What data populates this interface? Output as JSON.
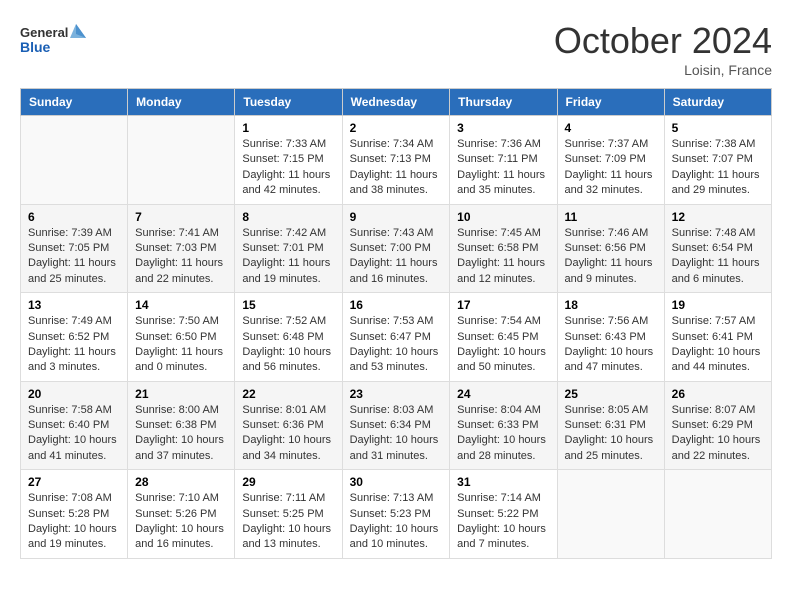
{
  "header": {
    "logo_general": "General",
    "logo_blue": "Blue",
    "month_title": "October 2024",
    "location": "Loisin, France"
  },
  "days_of_week": [
    "Sunday",
    "Monday",
    "Tuesday",
    "Wednesday",
    "Thursday",
    "Friday",
    "Saturday"
  ],
  "weeks": [
    [
      {
        "day": "",
        "sunrise": "",
        "sunset": "",
        "daylight": ""
      },
      {
        "day": "",
        "sunrise": "",
        "sunset": "",
        "daylight": ""
      },
      {
        "day": "1",
        "sunrise": "Sunrise: 7:33 AM",
        "sunset": "Sunset: 7:15 PM",
        "daylight": "Daylight: 11 hours and 42 minutes."
      },
      {
        "day": "2",
        "sunrise": "Sunrise: 7:34 AM",
        "sunset": "Sunset: 7:13 PM",
        "daylight": "Daylight: 11 hours and 38 minutes."
      },
      {
        "day": "3",
        "sunrise": "Sunrise: 7:36 AM",
        "sunset": "Sunset: 7:11 PM",
        "daylight": "Daylight: 11 hours and 35 minutes."
      },
      {
        "day": "4",
        "sunrise": "Sunrise: 7:37 AM",
        "sunset": "Sunset: 7:09 PM",
        "daylight": "Daylight: 11 hours and 32 minutes."
      },
      {
        "day": "5",
        "sunrise": "Sunrise: 7:38 AM",
        "sunset": "Sunset: 7:07 PM",
        "daylight": "Daylight: 11 hours and 29 minutes."
      }
    ],
    [
      {
        "day": "6",
        "sunrise": "Sunrise: 7:39 AM",
        "sunset": "Sunset: 7:05 PM",
        "daylight": "Daylight: 11 hours and 25 minutes."
      },
      {
        "day": "7",
        "sunrise": "Sunrise: 7:41 AM",
        "sunset": "Sunset: 7:03 PM",
        "daylight": "Daylight: 11 hours and 22 minutes."
      },
      {
        "day": "8",
        "sunrise": "Sunrise: 7:42 AM",
        "sunset": "Sunset: 7:01 PM",
        "daylight": "Daylight: 11 hours and 19 minutes."
      },
      {
        "day": "9",
        "sunrise": "Sunrise: 7:43 AM",
        "sunset": "Sunset: 7:00 PM",
        "daylight": "Daylight: 11 hours and 16 minutes."
      },
      {
        "day": "10",
        "sunrise": "Sunrise: 7:45 AM",
        "sunset": "Sunset: 6:58 PM",
        "daylight": "Daylight: 11 hours and 12 minutes."
      },
      {
        "day": "11",
        "sunrise": "Sunrise: 7:46 AM",
        "sunset": "Sunset: 6:56 PM",
        "daylight": "Daylight: 11 hours and 9 minutes."
      },
      {
        "day": "12",
        "sunrise": "Sunrise: 7:48 AM",
        "sunset": "Sunset: 6:54 PM",
        "daylight": "Daylight: 11 hours and 6 minutes."
      }
    ],
    [
      {
        "day": "13",
        "sunrise": "Sunrise: 7:49 AM",
        "sunset": "Sunset: 6:52 PM",
        "daylight": "Daylight: 11 hours and 3 minutes."
      },
      {
        "day": "14",
        "sunrise": "Sunrise: 7:50 AM",
        "sunset": "Sunset: 6:50 PM",
        "daylight": "Daylight: 11 hours and 0 minutes."
      },
      {
        "day": "15",
        "sunrise": "Sunrise: 7:52 AM",
        "sunset": "Sunset: 6:48 PM",
        "daylight": "Daylight: 10 hours and 56 minutes."
      },
      {
        "day": "16",
        "sunrise": "Sunrise: 7:53 AM",
        "sunset": "Sunset: 6:47 PM",
        "daylight": "Daylight: 10 hours and 53 minutes."
      },
      {
        "day": "17",
        "sunrise": "Sunrise: 7:54 AM",
        "sunset": "Sunset: 6:45 PM",
        "daylight": "Daylight: 10 hours and 50 minutes."
      },
      {
        "day": "18",
        "sunrise": "Sunrise: 7:56 AM",
        "sunset": "Sunset: 6:43 PM",
        "daylight": "Daylight: 10 hours and 47 minutes."
      },
      {
        "day": "19",
        "sunrise": "Sunrise: 7:57 AM",
        "sunset": "Sunset: 6:41 PM",
        "daylight": "Daylight: 10 hours and 44 minutes."
      }
    ],
    [
      {
        "day": "20",
        "sunrise": "Sunrise: 7:58 AM",
        "sunset": "Sunset: 6:40 PM",
        "daylight": "Daylight: 10 hours and 41 minutes."
      },
      {
        "day": "21",
        "sunrise": "Sunrise: 8:00 AM",
        "sunset": "Sunset: 6:38 PM",
        "daylight": "Daylight: 10 hours and 37 minutes."
      },
      {
        "day": "22",
        "sunrise": "Sunrise: 8:01 AM",
        "sunset": "Sunset: 6:36 PM",
        "daylight": "Daylight: 10 hours and 34 minutes."
      },
      {
        "day": "23",
        "sunrise": "Sunrise: 8:03 AM",
        "sunset": "Sunset: 6:34 PM",
        "daylight": "Daylight: 10 hours and 31 minutes."
      },
      {
        "day": "24",
        "sunrise": "Sunrise: 8:04 AM",
        "sunset": "Sunset: 6:33 PM",
        "daylight": "Daylight: 10 hours and 28 minutes."
      },
      {
        "day": "25",
        "sunrise": "Sunrise: 8:05 AM",
        "sunset": "Sunset: 6:31 PM",
        "daylight": "Daylight: 10 hours and 25 minutes."
      },
      {
        "day": "26",
        "sunrise": "Sunrise: 8:07 AM",
        "sunset": "Sunset: 6:29 PM",
        "daylight": "Daylight: 10 hours and 22 minutes."
      }
    ],
    [
      {
        "day": "27",
        "sunrise": "Sunrise: 7:08 AM",
        "sunset": "Sunset: 5:28 PM",
        "daylight": "Daylight: 10 hours and 19 minutes."
      },
      {
        "day": "28",
        "sunrise": "Sunrise: 7:10 AM",
        "sunset": "Sunset: 5:26 PM",
        "daylight": "Daylight: 10 hours and 16 minutes."
      },
      {
        "day": "29",
        "sunrise": "Sunrise: 7:11 AM",
        "sunset": "Sunset: 5:25 PM",
        "daylight": "Daylight: 10 hours and 13 minutes."
      },
      {
        "day": "30",
        "sunrise": "Sunrise: 7:13 AM",
        "sunset": "Sunset: 5:23 PM",
        "daylight": "Daylight: 10 hours and 10 minutes."
      },
      {
        "day": "31",
        "sunrise": "Sunrise: 7:14 AM",
        "sunset": "Sunset: 5:22 PM",
        "daylight": "Daylight: 10 hours and 7 minutes."
      },
      {
        "day": "",
        "sunrise": "",
        "sunset": "",
        "daylight": ""
      },
      {
        "day": "",
        "sunrise": "",
        "sunset": "",
        "daylight": ""
      }
    ]
  ]
}
